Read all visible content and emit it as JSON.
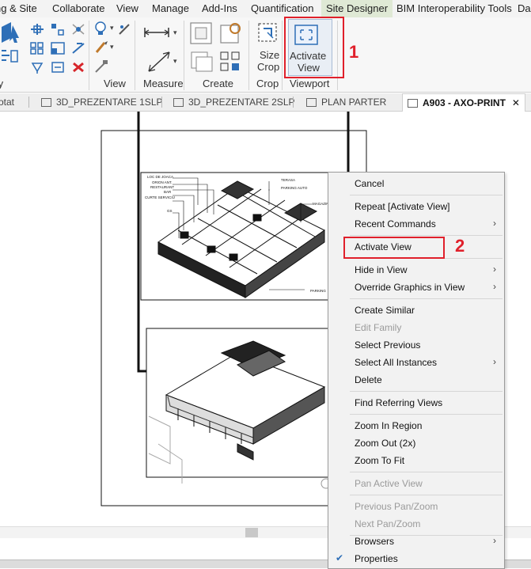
{
  "ribbon": {
    "tabs": [
      "ng & Site",
      "Collaborate",
      "View",
      "Manage",
      "Add-Ins",
      "Quantification",
      "Site Designer",
      "BIM Interoperability Tools",
      "Da"
    ],
    "active_tab": "Site Designer",
    "panel_labels": [
      "fy",
      "View",
      "Measure",
      "Create",
      "Crop",
      "Viewport"
    ],
    "size_crop_label": [
      "Size",
      "Crop"
    ],
    "activate_view_label": [
      "Activate",
      "View"
    ]
  },
  "view_tabs": [
    {
      "label": "otat"
    },
    {
      "label": "3D_PREZENTARE 1SLP"
    },
    {
      "label": "3D_PREZENTARE 2SLP"
    },
    {
      "label": "PLAN PARTER"
    },
    {
      "label": "A903 - AXO-PRINT",
      "active": true
    }
  ],
  "close_tab_glyph": "✕",
  "annotations": {
    "step1": "1",
    "step2": "2",
    "color": "#e0202b"
  },
  "drawing_labels": [
    "LOC DE JOACA",
    "ORION ANT.",
    "RESTAURANT",
    "BAR",
    "CURTE SERVICIU",
    "GS",
    "TERASA",
    "PARKING AUTO",
    "MAGAZIN",
    "PARKING"
  ],
  "context_menu": {
    "items": [
      {
        "label": "Cancel"
      },
      {
        "label": "Repeat [Activate View]"
      },
      {
        "label": "Recent Commands",
        "submenu": true
      },
      {
        "label": "Activate View",
        "highlighted": true
      },
      {
        "label": "Hide in View",
        "submenu": true
      },
      {
        "label": "Override Graphics in View",
        "submenu": true
      },
      {
        "label": "Create Similar"
      },
      {
        "label": "Edit Family",
        "disabled": true
      },
      {
        "label": "Select Previous"
      },
      {
        "label": "Select All Instances",
        "submenu": true
      },
      {
        "label": "Delete"
      },
      {
        "label": "Find Referring Views"
      },
      {
        "label": "Zoom In Region"
      },
      {
        "label": "Zoom Out (2x)"
      },
      {
        "label": "Zoom To Fit"
      },
      {
        "label": "Pan Active View",
        "disabled": true
      },
      {
        "label": "Previous Pan/Zoom",
        "disabled": true
      },
      {
        "label": "Next Pan/Zoom",
        "disabled": true
      },
      {
        "label": "Browsers",
        "submenu": true
      },
      {
        "label": "Properties",
        "checked": true
      }
    ],
    "submenu_glyph": "›",
    "check_glyph": "✔"
  },
  "colors": {
    "ribbon_active_tab": "#dfe9d5",
    "accent_blue": "#2e6fb7",
    "highlight_red": "#e0202b"
  }
}
